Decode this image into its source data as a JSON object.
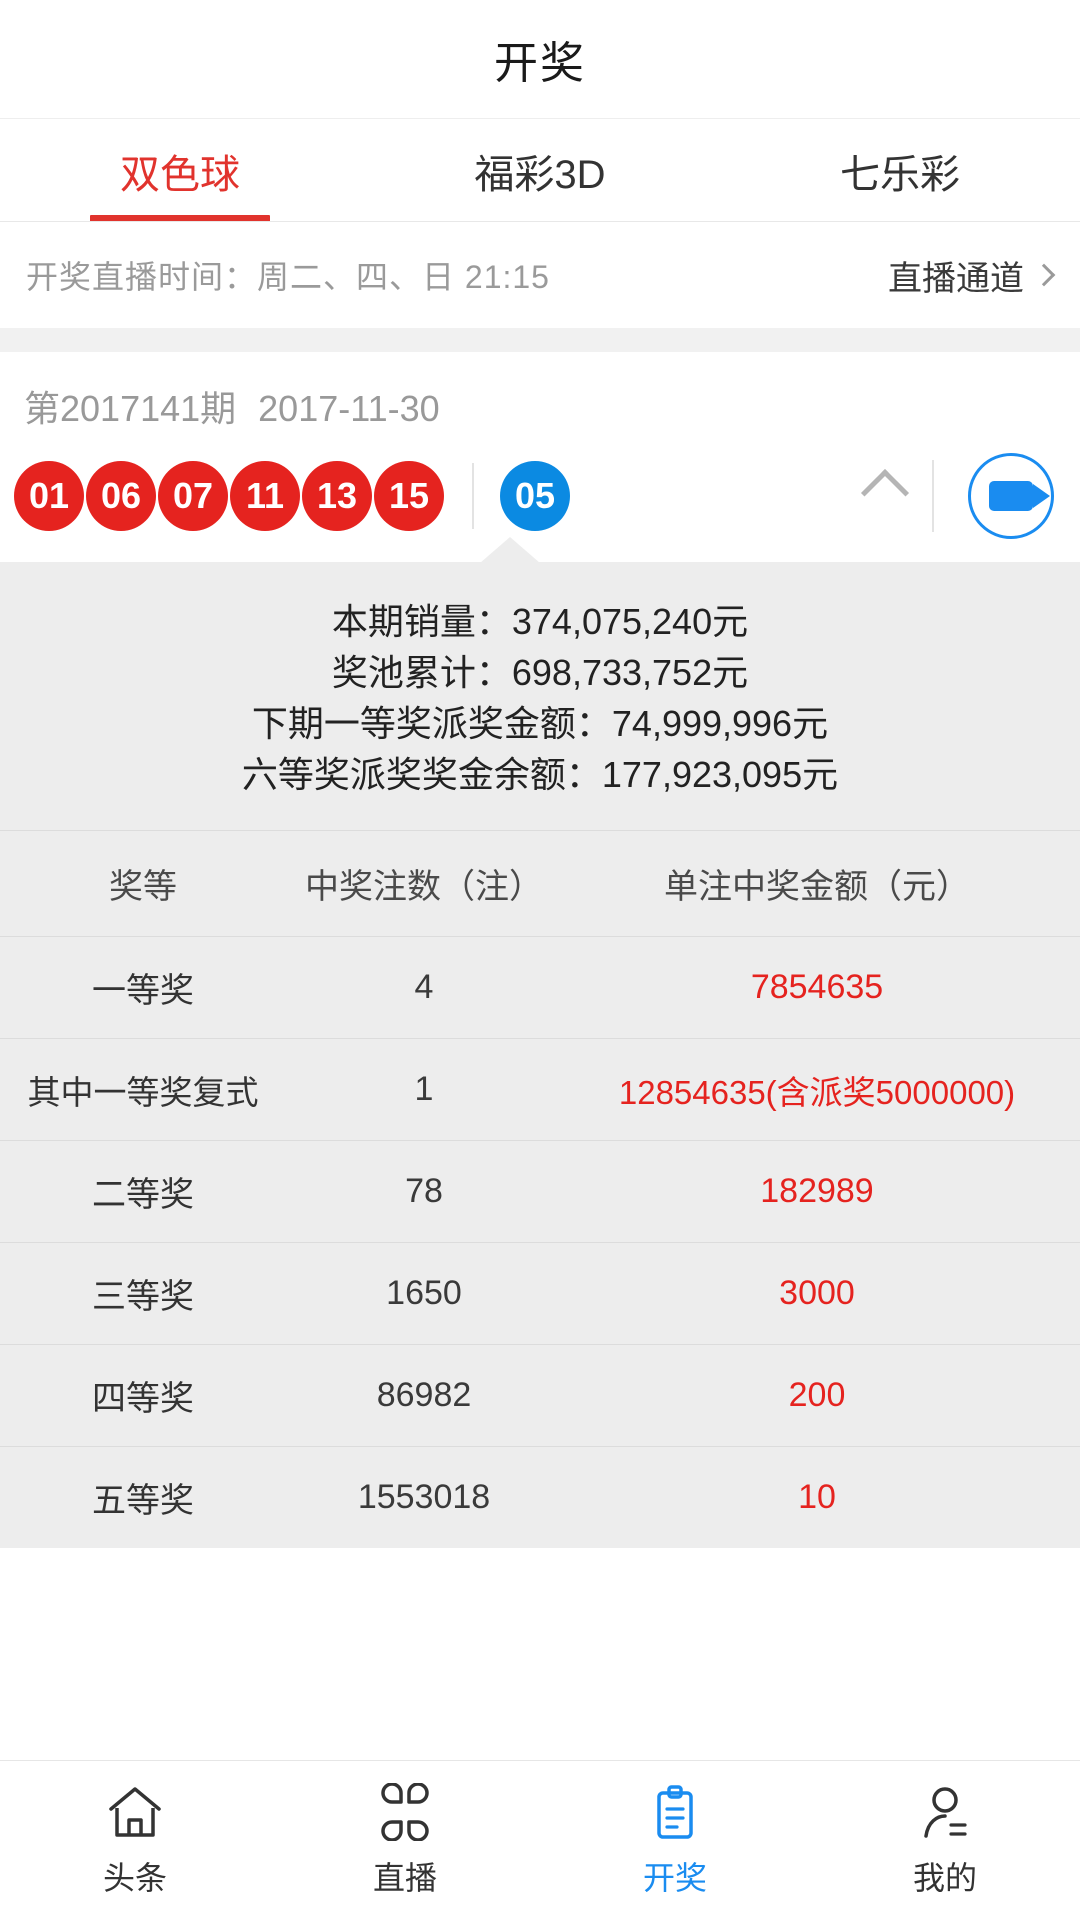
{
  "header": {
    "title": "开奖"
  },
  "tabs": [
    {
      "label": "双色球",
      "active": true
    },
    {
      "label": "福彩3D",
      "active": false
    },
    {
      "label": "七乐彩",
      "active": false
    }
  ],
  "info_bar": {
    "schedule_text": "开奖直播时间：周二、四、日 21:15",
    "live_link_label": "直播通道",
    "chevron_icon": "chevron-right-icon"
  },
  "draw": {
    "period": "第2017141期",
    "date": "2017-11-30",
    "red_balls": [
      "01",
      "06",
      "07",
      "11",
      "13",
      "15"
    ],
    "blue_balls": [
      "05"
    ],
    "collapse_icon": "chevron-up-icon",
    "video_icon": "video-camera-icon",
    "red_color": "#e5231f",
    "blue_color": "#0b8ae2"
  },
  "stats": [
    "本期销量：374,075,240元",
    "奖池累计：698,733,752元",
    "下期一等奖派奖金额：74,999,996元",
    "六等奖派奖奖金余额：177,923,095元"
  ],
  "prize_table": {
    "columns": [
      "奖等",
      "中奖注数（注）",
      "单注中奖金额（元）"
    ],
    "rows": [
      {
        "level": "一等奖",
        "count": "4",
        "amount": "7854635"
      },
      {
        "level": "其中一等奖复式",
        "count": "1",
        "amount": "12854635(含派奖5000000)"
      },
      {
        "level": "二等奖",
        "count": "78",
        "amount": "182989"
      },
      {
        "level": "三等奖",
        "count": "1650",
        "amount": "3000"
      },
      {
        "level": "四等奖",
        "count": "86982",
        "amount": "200"
      },
      {
        "level": "五等奖",
        "count": "1553018",
        "amount": "10"
      }
    ],
    "amount_color": "#e5231f"
  },
  "bottom_nav": [
    {
      "label": "头条",
      "icon": "home-icon",
      "active": false
    },
    {
      "label": "直播",
      "icon": "grid-flower-icon",
      "active": false
    },
    {
      "label": "开奖",
      "icon": "clipboard-icon",
      "active": true
    },
    {
      "label": "我的",
      "icon": "user-icon",
      "active": false
    }
  ],
  "theme": {
    "accent_red": "#e1332d",
    "accent_blue": "#1a8cf0",
    "panel_grey": "#ededed"
  }
}
